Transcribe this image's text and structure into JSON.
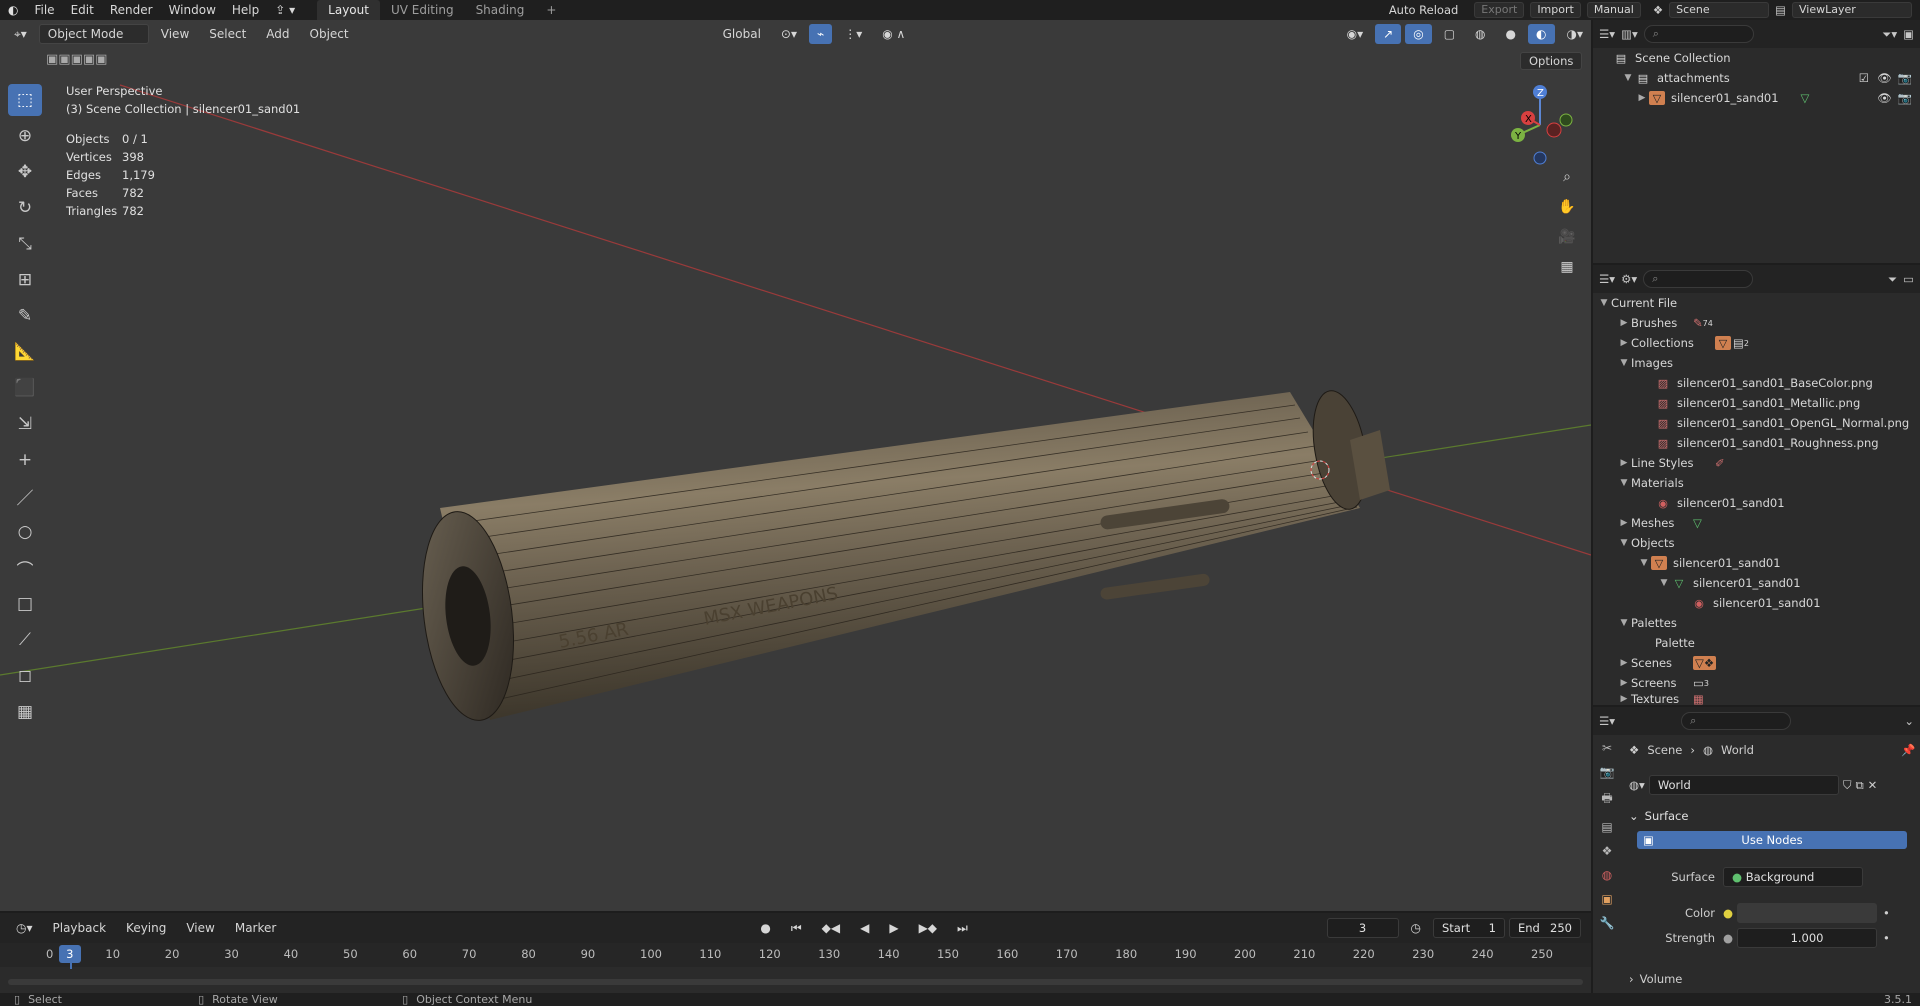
{
  "menu": {
    "file": "File",
    "edit": "Edit",
    "render": "Render",
    "window": "Window",
    "help": "Help"
  },
  "workspaces": [
    "Layout",
    "UV Editing",
    "Shading",
    "+"
  ],
  "topright": {
    "auto_reload": "Auto Reload",
    "export": "Export",
    "import": "Import",
    "manual": "Manual",
    "scene": "Scene",
    "view_layer": "ViewLayer"
  },
  "viewport": {
    "mode": "Object Mode",
    "view": "View",
    "select": "Select",
    "add": "Add",
    "object": "Object",
    "orientation": "Global",
    "options": "Options",
    "perspective": "User Perspective",
    "collection_info": "(3) Scene Collection | silencer01_sand01",
    "stats": [
      {
        "label": "Objects",
        "value": "0 / 1"
      },
      {
        "label": "Vertices",
        "value": "398"
      },
      {
        "label": "Edges",
        "value": "1,179"
      },
      {
        "label": "Faces",
        "value": "782"
      },
      {
        "label": "Triangles",
        "value": "782"
      }
    ],
    "model_text_1": "5.56 AR",
    "model_text_2": "MSX WEAPONS",
    "gizmo": {
      "x": "X",
      "y": "Y",
      "z": "Z"
    }
  },
  "outliner": {
    "title": "Scene Collection",
    "rows": [
      "attachments",
      "silencer01_sand01"
    ]
  },
  "blendfile": {
    "root": "Current File",
    "brushes": "Brushes",
    "brushes_count": "74",
    "collections": "Collections",
    "collections_count": "2",
    "images": "Images",
    "image_items": [
      "silencer01_sand01_BaseColor.png",
      "silencer01_sand01_Metallic.png",
      "silencer01_sand01_OpenGL_Normal.png",
      "silencer01_sand01_Roughness.png"
    ],
    "line_styles": "Line Styles",
    "materials": "Materials",
    "material_item": "silencer01_sand01",
    "meshes": "Meshes",
    "objects": "Objects",
    "object_item": "silencer01_sand01",
    "object_mesh": "silencer01_sand01",
    "object_mat": "silencer01_sand01",
    "palettes": "Palettes",
    "palette_item": "Palette",
    "scenes": "Scenes",
    "screens": "Screens",
    "screens_count": "3",
    "textures": "Textures"
  },
  "props": {
    "breadcrumb_scene": "Scene",
    "breadcrumb_world": "World",
    "world_name": "World",
    "surface_panel": "Surface",
    "use_nodes": "Use Nodes",
    "surface_label": "Surface",
    "surface_value": "Background",
    "color_label": "Color",
    "strength_label": "Strength",
    "strength_value": "1.000",
    "volume_panel": "Volume"
  },
  "timeline": {
    "playback": "Playback",
    "keying": "Keying",
    "view": "View",
    "marker": "Marker",
    "current_frame": "3",
    "start_label": "Start",
    "start_value": "1",
    "end_label": "End",
    "end_value": "250",
    "ticks": [
      "0",
      "10",
      "20",
      "30",
      "40",
      "50",
      "60",
      "70",
      "80",
      "90",
      "100",
      "110",
      "120",
      "130",
      "140",
      "150",
      "160",
      "170",
      "180",
      "190",
      "200",
      "210",
      "220",
      "230",
      "240",
      "250"
    ],
    "playhead": "3"
  },
  "status": {
    "select": "Select",
    "rotate": "Rotate View",
    "context": "Object Context Menu",
    "version": "3.5.1"
  }
}
